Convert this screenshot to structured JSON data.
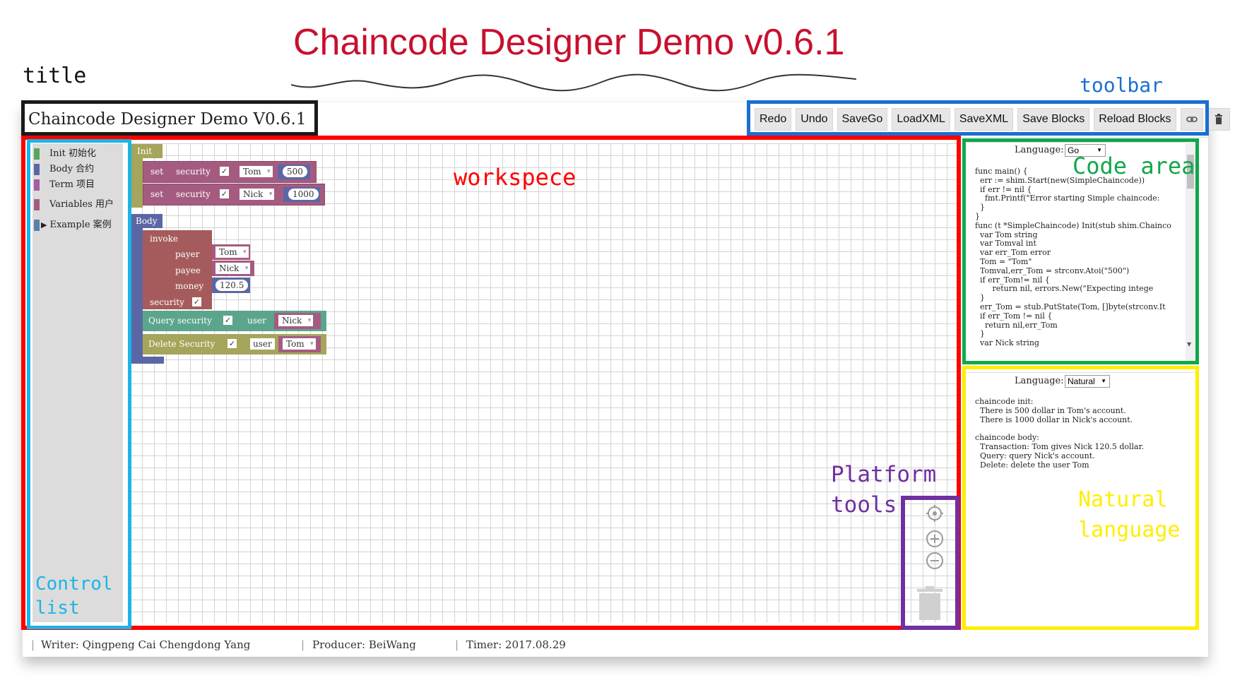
{
  "headline": "Chaincode Designer Demo v0.6.1",
  "annotations": {
    "title": "title",
    "toolbar": "toolbar",
    "workspace": "workspece",
    "code_area": "Code area",
    "platform_tools_line1": "Platform",
    "platform_tools_line2": "tools",
    "control_list_line1": "Control",
    "control_list_line2": "list",
    "natural_line1": "Natural",
    "natural_line2": "language"
  },
  "app": {
    "title": "Chaincode Designer Demo V0.6.1",
    "toolbar": [
      "Redo",
      "Undo",
      "SaveGo",
      "LoadXML",
      "SaveXML",
      "Save Blocks",
      "Reload Blocks"
    ],
    "toolbar_icons": [
      "link-icon",
      "trash-icon"
    ]
  },
  "sidebar": {
    "categories": [
      {
        "label": "Init 初始化",
        "color": "#5ba55b"
      },
      {
        "label": "Body 合约",
        "color": "#5b67a5"
      },
      {
        "label": "Term 项目",
        "color": "#a55ba5"
      },
      {
        "label": "Variables 用户",
        "color": "#a55b80"
      },
      {
        "label": "Example 案例",
        "color": "#5b80a5"
      }
    ]
  },
  "blocks": {
    "init_label": "Init",
    "init_rows": [
      {
        "set": "set",
        "security": "security",
        "check": "✓",
        "user": "Tom",
        "amount": "500"
      },
      {
        "set": "set",
        "security": "security",
        "check": "✓",
        "user": "Nick",
        "amount": "1000"
      }
    ],
    "body_label": "Body",
    "invoke_label": "invoke",
    "payer_label": "payer",
    "payer_value": "Tom",
    "payee_label": "payee",
    "payee_value": "Nick",
    "money_label": "money",
    "money_value": "120.5",
    "security_label": "security",
    "security_check": "✓",
    "query": {
      "label": "Query security",
      "check": "✓",
      "user_label": "user",
      "user": "Nick"
    },
    "delete": {
      "label": "Delete Security",
      "check": "✓",
      "user_label": "user",
      "user": "Tom"
    }
  },
  "code_panel": {
    "language_label": "Language:",
    "language_value": "Go",
    "lines": [
      "func main() {",
      "  err := shim.Start(new(SimpleChaincode))",
      "  if err != nil {",
      "    fmt.Printf(\"Error starting Simple chaincode:",
      "  }",
      "}",
      "func (t *SimpleChaincode) Init(stub shim.Chainco",
      "  var Tom string",
      "  var Tomval int",
      "  var err_Tom error",
      "  Tom = \"Tom\"",
      "  Tomval,err_Tom = strconv.Atoi(\"500\")",
      "  if err_Tom!= nil {",
      "       return nil, errors.New(\"Expecting intege",
      "  }",
      "  err_Tom = stub.PutState(Tom, []byte(strconv.It",
      "  if err_Tom != nil {",
      "    return nil,err_Tom",
      "  }",
      "  var Nick string"
    ]
  },
  "natural_panel": {
    "language_label": "Language:",
    "language_value": "Natural",
    "lines": [
      "chaincode init:",
      "  There is 500 dollar in Tom's account.",
      "  There is 1000 dollar in Nick's account.",
      "",
      "chaincode body:",
      "  Transaction: Tom gives Nick 120.5 dollar.",
      "  Query: query Nick's account.",
      "  Delete: delete the user Tom"
    ]
  },
  "footer": {
    "writer": "Writer: Qingpeng Cai  Chengdong Yang",
    "producer": "Producer: BeiWang",
    "timer": "Timer: 2017.08.29"
  },
  "colors": {
    "headline": "#c8102e",
    "title_frame": "#1a1a1a",
    "toolbar_frame": "#1a6fd1",
    "workspace_frame": "#ff0000",
    "code_frame": "#10a84a",
    "natural_frame": "#ffee00",
    "control_frame": "#1ab5e6",
    "platform_frame": "#7030a0"
  }
}
